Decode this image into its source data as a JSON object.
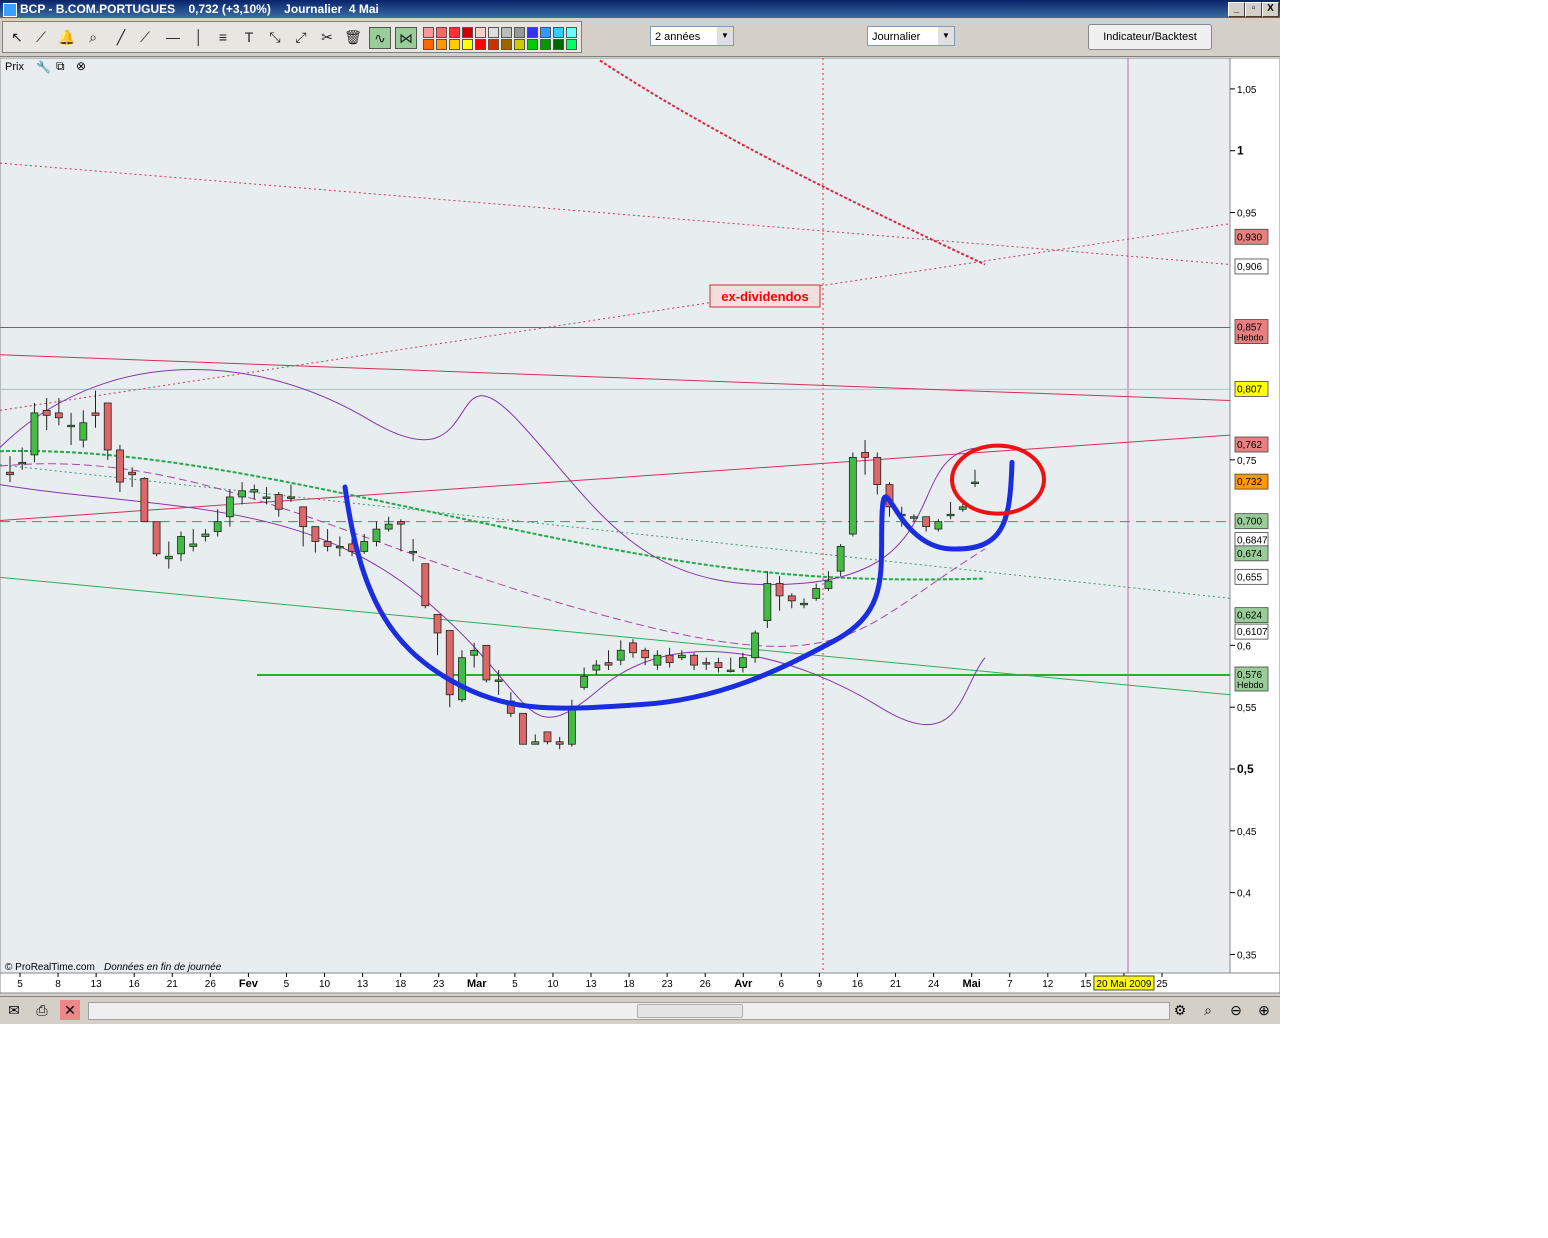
{
  "window": {
    "title": "BCP - B.COM.PORTUGUES    0,732 (+3,10%)    Journalier  4 Mai",
    "buttons": [
      "_",
      "▫",
      "X"
    ]
  },
  "toolbar": {
    "period_select": "2 années",
    "interval_select": "Journalier",
    "indicator_button": "Indicateur/Backtest",
    "palette": [
      "#ff9999",
      "#ff6666",
      "#ff3333",
      "#cc0000",
      "#ffcccc",
      "#dddddd",
      "#bbbbbb",
      "#999999",
      "#3333ff",
      "#3399ff",
      "#33ccff",
      "#66ffff",
      "#ff6600",
      "#ff9900",
      "#ffcc00",
      "#ffff00",
      "#ff0000",
      "#cc3300",
      "#996600",
      "#cccc00",
      "#00cc00",
      "#009900",
      "#006600",
      "#00ff66"
    ]
  },
  "panel": {
    "label": "Prix"
  },
  "footer": {
    "copyright": "© ProRealTime.com",
    "note": "Données en fin de journée"
  },
  "chart_data": {
    "type": "candlestick",
    "price_axis": {
      "min": 0.335,
      "max": 1.075,
      "ticks": [
        "1,05",
        "1",
        "0,95",
        "0,75",
        "0,6",
        "0,55",
        "0,5",
        "0,45",
        "0,4",
        "0,35"
      ],
      "tick_values": [
        1.05,
        1.0,
        0.95,
        0.75,
        0.6,
        0.55,
        0.5,
        0.45,
        0.4,
        0.35
      ],
      "bold_ticks": [
        "1",
        "0,5"
      ]
    },
    "x_labels": [
      "5",
      "8",
      "13",
      "16",
      "21",
      "26",
      "Fev",
      "5",
      "10",
      "13",
      "18",
      "23",
      "Mar",
      "5",
      "10",
      "13",
      "18",
      "23",
      "26",
      "Avr",
      "6",
      "9",
      "16",
      "21",
      "24",
      "Mai",
      "7",
      "12",
      "15",
      "20 Mai 2009",
      "25"
    ],
    "price_labels": [
      {
        "text": "0,930",
        "value": 0.93,
        "bg": "#e88080"
      },
      {
        "text": "0,906",
        "value": 0.906,
        "bg": "#ffffff"
      },
      {
        "text": "0,857",
        "sub": "Hebdo",
        "value": 0.857,
        "bg": "#e88080"
      },
      {
        "text": "0,807",
        "value": 0.807,
        "bg": "#ffff00"
      },
      {
        "text": "0,762",
        "value": 0.762,
        "bg": "#e88080"
      },
      {
        "text": "0,732",
        "value": 0.732,
        "bg": "#ff9900"
      },
      {
        "text": "0,700",
        "value": 0.7,
        "bg": "#99cc99"
      },
      {
        "text": "0,6847",
        "value": 0.6847,
        "bg": "#ffffff"
      },
      {
        "text": "0,674",
        "value": 0.674,
        "bg": "#99cc99"
      },
      {
        "text": "0,655",
        "value": 0.655,
        "bg": "#ffffff"
      },
      {
        "text": "0,624",
        "value": 0.624,
        "bg": "#99cc99"
      },
      {
        "text": "0,6107",
        "value": 0.6107,
        "bg": "#ffffff"
      },
      {
        "text": "0,576",
        "sub": "Hebdo",
        "value": 0.576,
        "bg": "#99cc99"
      }
    ],
    "annotation": {
      "text": "ex-dividendos",
      "color": "#ff0000"
    },
    "horizontal_levels": [
      {
        "value": 0.857,
        "color": "#dd3355",
        "style": "solid"
      },
      {
        "value": 0.807,
        "color": "#ff99cc",
        "style": "solid"
      },
      {
        "value": 0.7,
        "color": "#339966",
        "style": "dashed"
      },
      {
        "value": 0.576,
        "color": "#33aa33",
        "style": "solid"
      }
    ],
    "candles": [
      [
        0.74,
        0.738,
        0.753,
        0.732
      ],
      [
        0.748,
        0.748,
        0.76,
        0.742
      ],
      [
        0.754,
        0.788,
        0.796,
        0.748
      ],
      [
        0.79,
        0.786,
        0.8,
        0.774
      ],
      [
        0.788,
        0.784,
        0.8,
        0.778
      ],
      [
        0.778,
        0.778,
        0.788,
        0.762
      ],
      [
        0.766,
        0.78,
        0.79,
        0.76
      ],
      [
        0.788,
        0.786,
        0.806,
        0.776
      ],
      [
        0.796,
        0.758,
        0.796,
        0.75
      ],
      [
        0.758,
        0.732,
        0.762,
        0.724
      ],
      [
        0.74,
        0.738,
        0.744,
        0.728
      ],
      [
        0.735,
        0.7,
        0.736,
        0.7
      ],
      [
        0.7,
        0.674,
        0.7,
        0.672
      ],
      [
        0.67,
        0.672,
        0.684,
        0.662
      ],
      [
        0.674,
        0.688,
        0.692,
        0.668
      ],
      [
        0.68,
        0.682,
        0.694,
        0.676
      ],
      [
        0.688,
        0.69,
        0.694,
        0.684
      ],
      [
        0.692,
        0.7,
        0.71,
        0.688
      ],
      [
        0.704,
        0.72,
        0.726,
        0.696
      ],
      [
        0.72,
        0.725,
        0.732,
        0.714
      ],
      [
        0.724,
        0.726,
        0.73,
        0.718
      ],
      [
        0.72,
        0.72,
        0.728,
        0.714
      ],
      [
        0.722,
        0.71,
        0.724,
        0.704
      ],
      [
        0.72,
        0.72,
        0.73,
        0.716
      ],
      [
        0.712,
        0.696,
        0.712,
        0.68
      ],
      [
        0.696,
        0.684,
        0.696,
        0.675
      ],
      [
        0.684,
        0.68,
        0.694,
        0.676
      ],
      [
        0.68,
        0.68,
        0.688,
        0.672
      ],
      [
        0.682,
        0.676,
        0.686,
        0.672
      ],
      [
        0.676,
        0.684,
        0.69,
        0.674
      ],
      [
        0.684,
        0.694,
        0.7,
        0.68
      ],
      [
        0.694,
        0.698,
        0.704,
        0.692
      ],
      [
        0.7,
        0.698,
        0.702,
        0.676
      ],
      [
        0.676,
        0.676,
        0.686,
        0.668
      ],
      [
        0.666,
        0.632,
        0.666,
        0.63
      ],
      [
        0.625,
        0.61,
        0.625,
        0.592
      ],
      [
        0.612,
        0.56,
        0.612,
        0.55
      ],
      [
        0.556,
        0.59,
        0.596,
        0.554
      ],
      [
        0.592,
        0.596,
        0.602,
        0.582
      ],
      [
        0.6,
        0.572,
        0.6,
        0.57
      ],
      [
        0.572,
        0.572,
        0.58,
        0.56
      ],
      [
        0.555,
        0.545,
        0.562,
        0.542
      ],
      [
        0.545,
        0.52,
        0.545,
        0.52
      ],
      [
        0.52,
        0.522,
        0.528,
        0.52
      ],
      [
        0.53,
        0.522,
        0.53,
        0.52
      ],
      [
        0.522,
        0.52,
        0.526,
        0.516
      ],
      [
        0.52,
        0.548,
        0.556,
        0.518
      ],
      [
        0.566,
        0.575,
        0.582,
        0.564
      ],
      [
        0.58,
        0.584,
        0.588,
        0.576
      ],
      [
        0.586,
        0.584,
        0.596,
        0.58
      ],
      [
        0.588,
        0.596,
        0.604,
        0.584
      ],
      [
        0.602,
        0.594,
        0.605,
        0.59
      ],
      [
        0.596,
        0.59,
        0.598,
        0.584
      ],
      [
        0.584,
        0.592,
        0.596,
        0.58
      ],
      [
        0.592,
        0.586,
        0.598,
        0.582
      ],
      [
        0.59,
        0.592,
        0.596,
        0.588
      ],
      [
        0.592,
        0.584,
        0.594,
        0.58
      ],
      [
        0.586,
        0.586,
        0.59,
        0.58
      ],
      [
        0.586,
        0.582,
        0.59,
        0.578
      ],
      [
        0.58,
        0.58,
        0.59,
        0.578
      ],
      [
        0.582,
        0.59,
        0.594,
        0.578
      ],
      [
        0.59,
        0.61,
        0.612,
        0.586
      ],
      [
        0.62,
        0.65,
        0.66,
        0.614
      ],
      [
        0.65,
        0.64,
        0.656,
        0.628
      ],
      [
        0.64,
        0.636,
        0.642,
        0.63
      ],
      [
        0.634,
        0.634,
        0.638,
        0.63
      ],
      [
        0.638,
        0.646,
        0.65,
        0.636
      ],
      [
        0.646,
        0.652,
        0.66,
        0.644
      ],
      [
        0.66,
        0.68,
        0.682,
        0.656
      ],
      [
        0.69,
        0.752,
        0.756,
        0.688
      ],
      [
        0.756,
        0.752,
        0.766,
        0.738
      ],
      [
        0.752,
        0.73,
        0.756,
        0.722
      ],
      [
        0.73,
        0.712,
        0.732,
        0.704
      ],
      [
        0.706,
        0.706,
        0.712,
        0.696
      ],
      [
        0.704,
        0.703,
        0.706,
        0.7
      ],
      [
        0.704,
        0.696,
        0.704,
        0.692
      ],
      [
        0.694,
        0.7,
        0.702,
        0.692
      ],
      [
        0.706,
        0.706,
        0.716,
        0.702
      ],
      [
        0.71,
        0.712,
        0.718,
        0.708
      ],
      [
        0.732,
        0.732,
        0.742,
        0.728
      ]
    ]
  }
}
